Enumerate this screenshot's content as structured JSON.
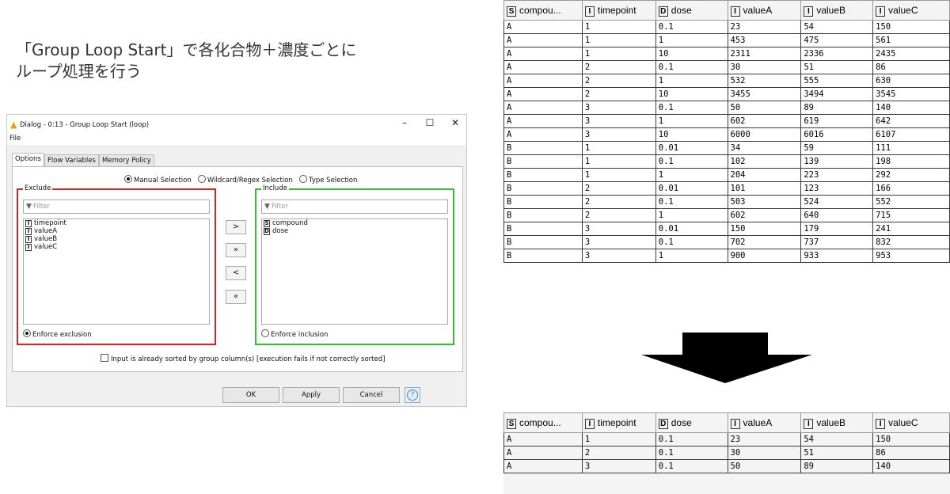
{
  "caption": {
    "line1": "「Group Loop Start」で各化合物＋濃度ごとに",
    "line2": "ループ処理を行う"
  },
  "dialog": {
    "title": "Dialog - 0:13 - Group Loop Start (loop)",
    "menu_file": "File",
    "tabs": [
      "Options",
      "Flow Variables",
      "Memory Policy"
    ],
    "radio_options": [
      "Manual Selection",
      "Wildcard/Regex Selection",
      "Type Selection"
    ],
    "exclude": {
      "label": "Exclude",
      "filter_placeholder": "Filter",
      "items": [
        {
          "type": "I",
          "name": "timepoint"
        },
        {
          "type": "I",
          "name": "valueA"
        },
        {
          "type": "I",
          "name": "valueB"
        },
        {
          "type": "I",
          "name": "valueC"
        }
      ],
      "enforce_label": "Enforce exclusion"
    },
    "include": {
      "label": "Include",
      "filter_placeholder": "Filter",
      "items": [
        {
          "type": "S",
          "name": "compound"
        },
        {
          "type": "D",
          "name": "dose"
        }
      ],
      "enforce_label": "Enforce inclusion"
    },
    "move_buttons": [
      ">",
      "»",
      "<",
      "«"
    ],
    "sorted_checkbox_label": "Input is already sorted by group column(s) [execution fails if not correctly sorted]",
    "ok": "OK",
    "apply": "Apply",
    "cancel": "Cancel",
    "help": "?"
  },
  "table_top": {
    "columns": [
      {
        "type": "S",
        "name": "compou..."
      },
      {
        "type": "I",
        "name": "timepoint"
      },
      {
        "type": "D",
        "name": "dose"
      },
      {
        "type": "I",
        "name": "valueA"
      },
      {
        "type": "I",
        "name": "valueB"
      },
      {
        "type": "I",
        "name": "valueC"
      }
    ],
    "rows": [
      [
        "A",
        "1",
        "0.1",
        "23",
        "54",
        "150"
      ],
      [
        "A",
        "1",
        "1",
        "453",
        "475",
        "561"
      ],
      [
        "A",
        "1",
        "10",
        "2311",
        "2336",
        "2435"
      ],
      [
        "A",
        "2",
        "0.1",
        "30",
        "51",
        "86"
      ],
      [
        "A",
        "2",
        "1",
        "532",
        "555",
        "630"
      ],
      [
        "A",
        "2",
        "10",
        "3455",
        "3494",
        "3545"
      ],
      [
        "A",
        "3",
        "0.1",
        "50",
        "89",
        "140"
      ],
      [
        "A",
        "3",
        "1",
        "602",
        "619",
        "642"
      ],
      [
        "A",
        "3",
        "10",
        "6000",
        "6016",
        "6107"
      ],
      [
        "B",
        "1",
        "0.01",
        "34",
        "59",
        "111"
      ],
      [
        "B",
        "1",
        "0.1",
        "102",
        "139",
        "198"
      ],
      [
        "B",
        "1",
        "1",
        "204",
        "223",
        "292"
      ],
      [
        "B",
        "2",
        "0.01",
        "101",
        "123",
        "166"
      ],
      [
        "B",
        "2",
        "0.1",
        "503",
        "524",
        "552"
      ],
      [
        "B",
        "2",
        "1",
        "602",
        "640",
        "715"
      ],
      [
        "B",
        "3",
        "0.01",
        "150",
        "179",
        "241"
      ],
      [
        "B",
        "3",
        "0.1",
        "702",
        "737",
        "832"
      ],
      [
        "B",
        "3",
        "1",
        "900",
        "933",
        "953"
      ]
    ]
  },
  "table_bottom": {
    "columns": [
      {
        "type": "S",
        "name": "compou..."
      },
      {
        "type": "I",
        "name": "timepoint"
      },
      {
        "type": "D",
        "name": "dose"
      },
      {
        "type": "I",
        "name": "valueA"
      },
      {
        "type": "I",
        "name": "valueB"
      },
      {
        "type": "I",
        "name": "valueC"
      }
    ],
    "rows": [
      [
        "A",
        "1",
        "0.1",
        "23",
        "54",
        "150"
      ],
      [
        "A",
        "2",
        "0.1",
        "30",
        "51",
        "86"
      ],
      [
        "A",
        "3",
        "0.1",
        "50",
        "89",
        "140"
      ]
    ]
  },
  "icons": {
    "warning": "warning-icon",
    "filter": "filter-icon",
    "arrow": "down-arrow-icon"
  }
}
